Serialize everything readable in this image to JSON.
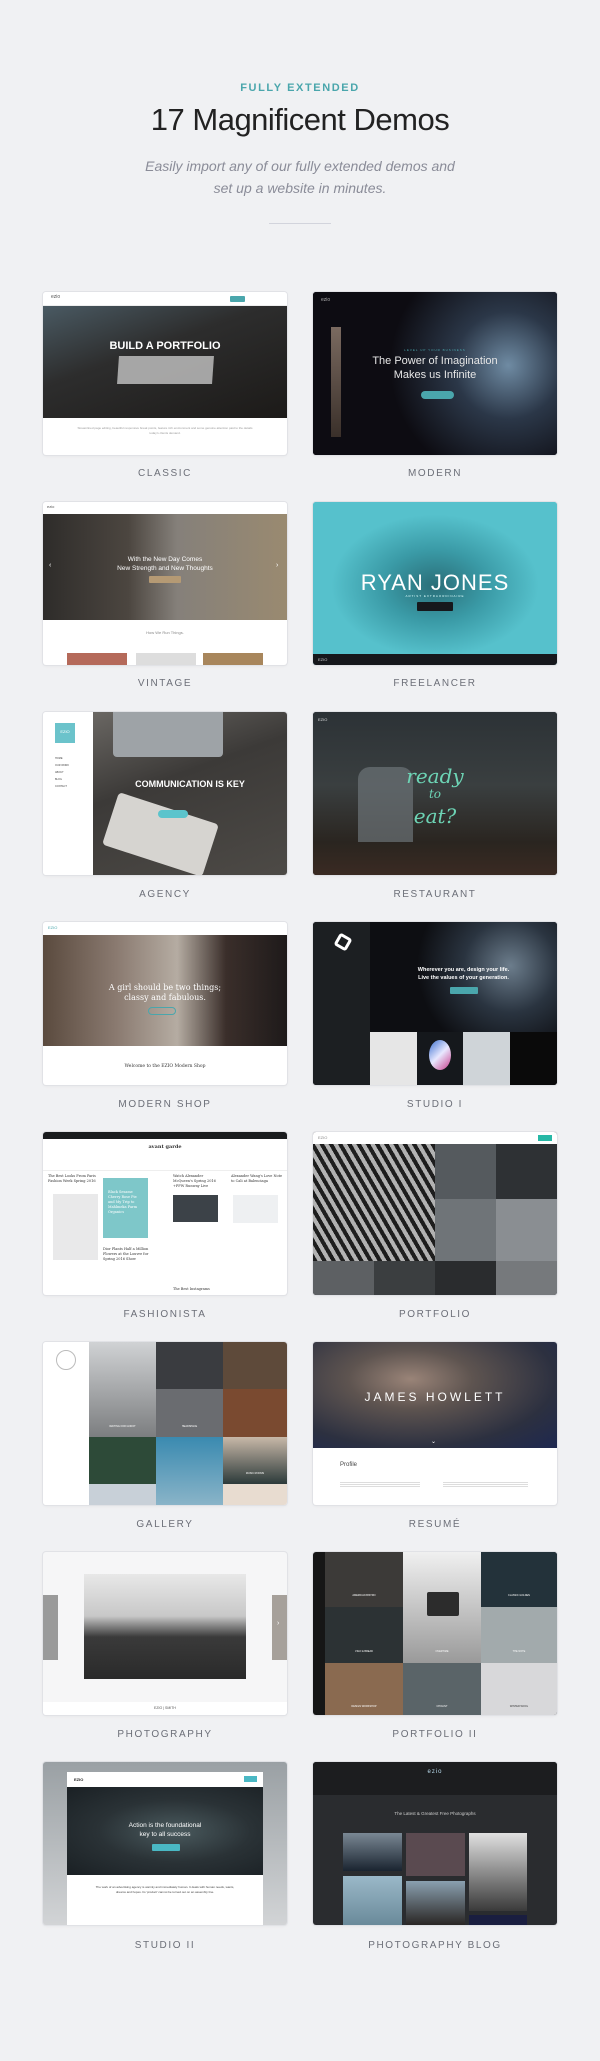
{
  "header": {
    "eyebrow": "FULLY EXTENDED",
    "title": "17 Magnificent Demos",
    "subtitle_line1": "Easily import any of our fully extended demos and",
    "subtitle_line2": "set up a website in minutes."
  },
  "colors": {
    "accent": "#4aa6ac",
    "background": "#f0f1f3",
    "label": "#6c6f78"
  },
  "demos": [
    {
      "label": "CLASSIC",
      "logo": "ezio",
      "hero": "BUILD A PORTFOLIO",
      "body": "Streamlined page editing, beautiful responsive break points, feature rich environment and some genuine attention paid to the details today's clients demand."
    },
    {
      "label": "MODERN",
      "logo": "ezio",
      "eyebrow": "LEVEL UP YOUR BUSINESS",
      "hero_line1": "The Power of Imagination",
      "hero_line2": "Makes us Infinite"
    },
    {
      "label": "VINTAGE",
      "logo": "ezio",
      "hero_line1": "With the New Day Comes",
      "hero_line2": "New Strength and New Thoughts",
      "section_title": "How We Run Things."
    },
    {
      "label": "FREELANCER",
      "logo": "EZIO",
      "hero": "RYAN JONES",
      "tagline": "ARTIST EXTRAORDINAIRE"
    },
    {
      "label": "AGENCY",
      "logo": "EZIO",
      "hero": "COMMUNICATION IS KEY",
      "menu": [
        "HOME",
        "OUR WORK",
        "ABOUT",
        "BLOG",
        "CONTACT"
      ]
    },
    {
      "label": "RESTAURANT",
      "logo": "EZIO",
      "hero_line1": "ready",
      "hero_line2": "to",
      "hero_line3": "eat?"
    },
    {
      "label": "MODERN SHOP",
      "logo": "EZIO",
      "hero_line1": "A girl should be two things;",
      "hero_line2": "classy and fabulous.",
      "section_title": "Welcome to the EZIO Modern Shop"
    },
    {
      "label": "STUDIO I",
      "hero_line1": "Wherever you are, design your life.",
      "hero_line2": "Live the values of your generation."
    },
    {
      "label": "FASHIONISTA",
      "logo": "avant garde",
      "posts": [
        "The Best Looks From Paris Fashion Week Spring 2016",
        "Black Sesame Cherry Rose Pie and My Trip to Mahlmeka Farm Organics",
        "Watch Alexander McQueen's Spring 2016 +PFW Runway Live",
        "Alexander Wang's Love Note to Cali at Balenciaga",
        "Dior Plants Half a Million Flowers at the Louvre for Spring 2016 Show",
        "The Best Instagrams"
      ]
    },
    {
      "label": "PORTFOLIO",
      "logo": "EZIO"
    },
    {
      "label": "GALLERY",
      "tiles": [
        "WAITING FOR GODOT",
        "HEADSPACE",
        "MUSIC ROOMS"
      ]
    },
    {
      "label": "RESUMÉ",
      "hero": "JAMES HOWLETT",
      "section_title": "Profile"
    },
    {
      "label": "PHOTOGRAPHY",
      "logo": "EZIO | SMITH"
    },
    {
      "label": "PORTFOLIO II",
      "tiles": [
        "AMERICAN BISTRO",
        "CLASSIC GOLDEN",
        "VIGO & BREAD",
        "OVERTIME",
        "THE NOTE",
        "DESIGN WORKSHOP",
        "CHOLINT",
        "WINTER WOOL"
      ]
    },
    {
      "label": "STUDIO II",
      "logo": "EZIO",
      "hero_line1": "Action is the foundational",
      "hero_line2": "key to all success",
      "body": "The work of an advertising agency is warmly and immediately human. It deals with human needs, wants, dreams and hopes. Its 'product' cannot be turned out on an assembly line."
    },
    {
      "label": "PHOTOGRAPHY BLOG",
      "logo": "ezio",
      "section_title": "The Latest & Greatest Free Photographs"
    }
  ]
}
